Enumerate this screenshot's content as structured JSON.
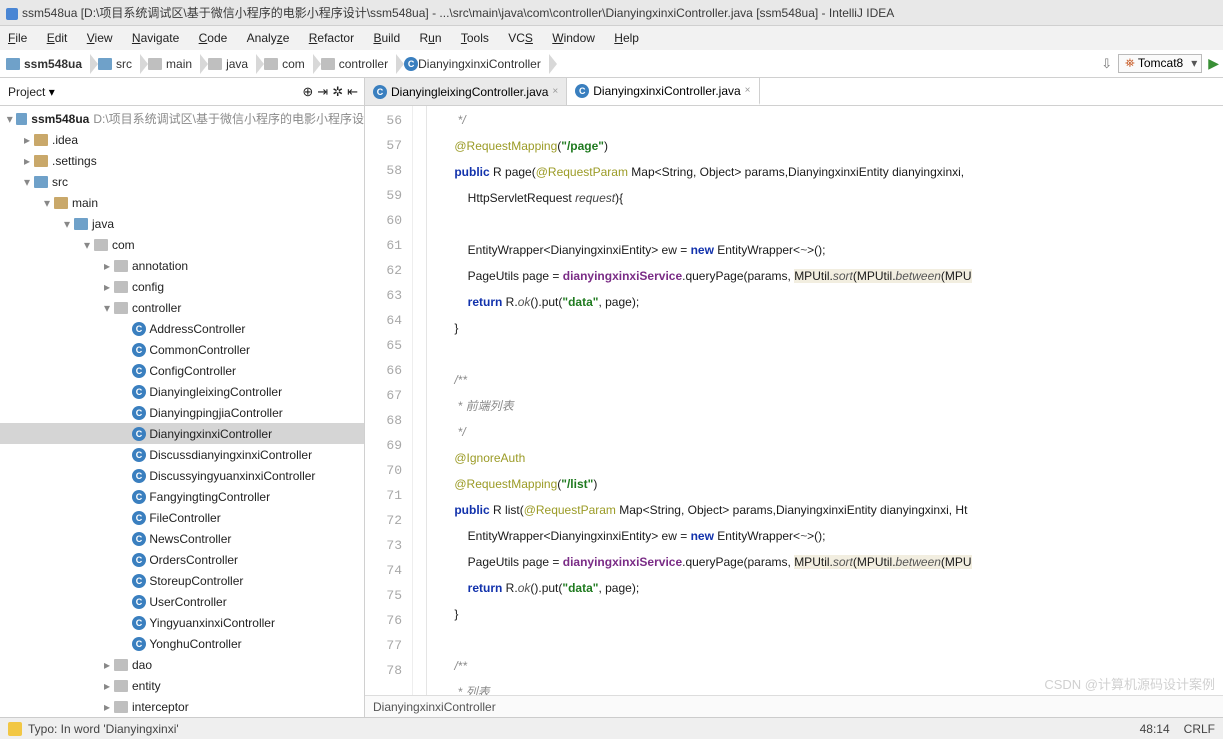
{
  "title": "ssm548ua [D:\\项目系统调试区\\基于微信小程序的电影小程序设计\\ssm548ua] - ...\\src\\main\\java\\com\\controller\\DianyingxinxiController.java [ssm548ua] - IntelliJ IDEA",
  "menu": {
    "file": "File",
    "edit": "Edit",
    "view": "View",
    "navigate": "Navigate",
    "code": "Code",
    "analyze": "Analyze",
    "refactor": "Refactor",
    "build": "Build",
    "run": "Run",
    "tools": "Tools",
    "vcs": "VCS",
    "window": "Window",
    "help": "Help"
  },
  "breadcrumbs": [
    "ssm548ua",
    "src",
    "main",
    "java",
    "com",
    "controller",
    "DianyingxinxiController"
  ],
  "runConfig": "Tomcat8",
  "projectPanel": {
    "title": "Project"
  },
  "tabs": [
    {
      "label": "DianyingleixingController.java",
      "active": false
    },
    {
      "label": "DianyingxinxiController.java",
      "active": true
    }
  ],
  "tree": {
    "root": "ssm548ua",
    "rootPath": "D:\\项目系统调试区\\基于微信小程序的电影小程序设",
    "idea": ".idea",
    "settings": ".settings",
    "src": "src",
    "main_": "main",
    "java_": "java",
    "com_": "com",
    "pkg": {
      "annotation": "annotation",
      "config": "config",
      "controller": "controller",
      "dao": "dao",
      "entity": "entity",
      "interceptor": "interceptor"
    },
    "ctrl": {
      "AddressController": "AddressController",
      "CommonController": "CommonController",
      "ConfigController": "ConfigController",
      "DianyingleixingController": "DianyingleixingController",
      "DianyingpingjiaController": "DianyingpingjiaController",
      "DianyingxinxiController": "DianyingxinxiController",
      "DiscussdianyingxinxiController": "DiscussdianyingxinxiController",
      "DiscussyingyuanxinxiController": "DiscussyingyuanxinxiController",
      "FangyingtingController": "FangyingtingController",
      "FileController": "FileController",
      "NewsController": "NewsController",
      "OrdersController": "OrdersController",
      "StoreupController": "StoreupController",
      "UserController": "UserController",
      "YingyuanxinxiController": "YingyuanxinxiController",
      "YonghuController": "YonghuController"
    }
  },
  "lineStart": 56,
  "lineEnd": 78,
  "code": {
    "c56": "     */",
    "c57a": "    ",
    "c57_ann": "@RequestMapping",
    "c57b": "(",
    "c57_s": "\"/page\"",
    "c57c": ")",
    "c58a": "    ",
    "c58_kw": "public",
    "c58b": " R page(",
    "c58_ann": "@RequestParam",
    "c58c": " Map<String, Object> params,DianyingxinxiEntity dianyingxinxi,",
    "c59a": "        HttpServletRequest ",
    "c59_p": "request",
    "c59b": "){",
    "c60": "",
    "c61a": "        EntityWrapper<DianyingxinxiEntity> ew = ",
    "c61_kw": "new",
    "c61b": " EntityWrapper<",
    "c61_it": "~",
    "c61c": ">();",
    "c62a": "        PageUtils page = ",
    "c62_f": "dianyingxinxiService",
    "c62b": ".queryPage(params, ",
    "c62_hl1": "MPUtil.",
    "c62_i1": "sort",
    "c62_hl2": "(MPUtil.",
    "c62_i2": "between",
    "c62_hl3": "(MPU",
    "c63a": "        ",
    "c63_kw": "return",
    "c63b": " R.",
    "c63_i": "ok",
    "c63c": "().put(",
    "c63_s": "\"data\"",
    "c63d": ", page);",
    "c64": "    }",
    "c65": "",
    "c66": "    /**",
    "c67": "     * 前端列表",
    "c68": "     */",
    "c69a": "    ",
    "c69_ann": "@IgnoreAuth",
    "c70a": "    ",
    "c70_ann": "@RequestMapping",
    "c70b": "(",
    "c70_s": "\"/list\"",
    "c70c": ")",
    "c71a": "    ",
    "c71_kw": "public",
    "c71b": " R list(",
    "c71_ann": "@RequestParam",
    "c71c": " Map<String, Object> params,DianyingxinxiEntity dianyingxinxi, Ht",
    "c72a": "        EntityWrapper<DianyingxinxiEntity> ew = ",
    "c72_kw": "new",
    "c72b": " EntityWrapper<",
    "c72_it": "~",
    "c72c": ">();",
    "c73a": "        PageUtils page = ",
    "c73_f": "dianyingxinxiService",
    "c73b": ".queryPage(params, ",
    "c73_hl1": "MPUtil.",
    "c73_i1": "sort",
    "c73_hl2": "(MPUtil.",
    "c73_i2": "between",
    "c73_hl3": "(MPU",
    "c74a": "        ",
    "c74_kw": "return",
    "c74b": " R.",
    "c74_i": "ok",
    "c74c": "().put(",
    "c74_s": "\"data\"",
    "c74d": ", page);",
    "c75": "    }",
    "c76": "",
    "c77": "    /**",
    "c78": "     * 列表"
  },
  "editorCrumb": "DianyingxinxiController",
  "status": {
    "msg": "Typo: In word 'Dianyingxinxi'",
    "pos": "48:14",
    "enc": "CRLF"
  },
  "watermark": "CSDN @计算机源码设计案例"
}
